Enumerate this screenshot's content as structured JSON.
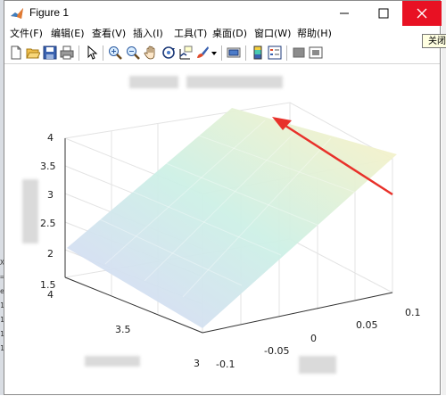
{
  "window": {
    "title": "Figure 1",
    "close_tooltip": "关闭",
    "minimize_glyph": "—",
    "maximize_glyph": "☐",
    "close_glyph": "✕"
  },
  "menu": [
    {
      "label": "文件(F)"
    },
    {
      "label": "编辑(E)"
    },
    {
      "label": "查看(V)"
    },
    {
      "label": "插入(I)"
    },
    {
      "label": "工具(T)"
    },
    {
      "label": "桌面(D)"
    },
    {
      "label": "窗口(W)"
    },
    {
      "label": "帮助(H)"
    }
  ],
  "toolbar": {
    "icons": [
      "new-figure-icon",
      "open-file-icon",
      "save-icon",
      "print-icon",
      "pointer-icon",
      "zoom-in-icon",
      "zoom-out-icon",
      "pan-icon",
      "rotate-3d-icon",
      "data-cursor-icon",
      "brush-icon",
      "dropdown-arrow-icon",
      "link-plot-icon",
      "colorbar-icon",
      "legend-icon",
      "hide-plot-tools-icon",
      "show-plot-tools-icon"
    ]
  },
  "axes": {
    "z_ticks": [
      "4",
      "3.5",
      "3",
      "2.5",
      "2",
      "1.5"
    ],
    "y_ticks": [
      "4",
      "3.5",
      "3"
    ],
    "x_ticks": [
      "-0.1",
      "-0.05",
      "0",
      "0.05",
      "0.1"
    ]
  },
  "colors": {
    "close_button": "#e81123",
    "annotation_arrow": "#e8312a",
    "surface_low": "#d9d6f8",
    "surface_mid": "#cdf0e6",
    "surface_high": "#fdf2c4"
  }
}
